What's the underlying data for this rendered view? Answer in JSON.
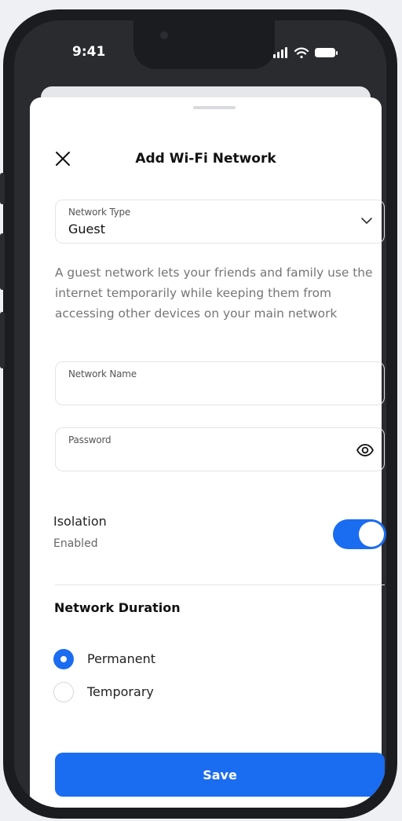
{
  "status_bar": {
    "time": "9:41"
  },
  "header": {
    "title": "Add Wi-Fi Network"
  },
  "network_type": {
    "label": "Network Type",
    "value": "Guest",
    "description": "A guest network lets your friends and family use the internet temporarily while keeping them from accessing other devices on your main network"
  },
  "network_name": {
    "label": "Network Name",
    "value": ""
  },
  "password": {
    "label": "Password",
    "value": ""
  },
  "isolation": {
    "label": "Isolation",
    "status": "Enabled",
    "on": true
  },
  "duration": {
    "title": "Network Duration",
    "options": [
      {
        "label": "Permanent",
        "selected": true
      },
      {
        "label": "Temporary",
        "selected": false
      }
    ]
  },
  "save_label": "Save",
  "colors": {
    "accent": "#1a6cf0"
  }
}
